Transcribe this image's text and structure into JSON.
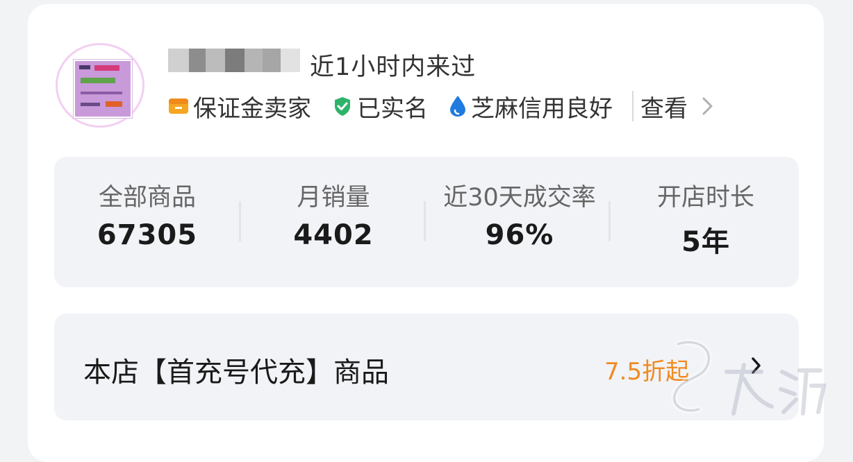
{
  "shop": {
    "last_active": "近1小时内来过",
    "badges": {
      "deposit": "保证金卖家",
      "verified": "已实名",
      "credit": "芝麻信用良好"
    },
    "view_label": "查看"
  },
  "stats": [
    {
      "label": "全部商品",
      "value": "67305"
    },
    {
      "label": "月销量",
      "value": "4402"
    },
    {
      "label": "近30天成交率",
      "value": "96%"
    },
    {
      "label": "开店时长",
      "value": "5年"
    }
  ],
  "promo": {
    "title": "本店【首充号代充】商品",
    "discount": "7.5折起"
  },
  "colors": {
    "accent_orange": "#ef8a1f",
    "verified_green": "#2fb36a",
    "credit_blue": "#1f7be0"
  }
}
